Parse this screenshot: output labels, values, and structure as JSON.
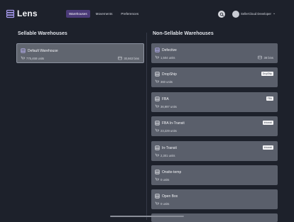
{
  "app": {
    "name": "Lens"
  },
  "nav": {
    "items": [
      "Warehouses",
      "Movements",
      "Preferences"
    ]
  },
  "user": {
    "name": "SellerCloud Developer"
  },
  "sections": {
    "sellable_title": "Sellable Warehouses",
    "nonsellable_title": "Non-Sellable Warehouses"
  },
  "sellable": [
    {
      "name": "Default Warehouse",
      "units": "775,468 units",
      "bins": "30,663 bins"
    }
  ],
  "nonsellable": [
    {
      "name": "Defective",
      "units": "1,504 units",
      "bins": "38 bins",
      "badge": ""
    },
    {
      "name": "DropShip",
      "units": "360 units",
      "bins": "",
      "badge": "DropShip"
    },
    {
      "name": "FBA",
      "units": "36,997 units",
      "bins": "",
      "badge": "FBA"
    },
    {
      "name": "FBA In-Transit",
      "units": "23,229 units",
      "bins": "",
      "badge": "Intransit"
    },
    {
      "name": "In-Transit",
      "units": "2,301 units",
      "bins": "",
      "badge": "Intransit"
    },
    {
      "name": "Onsite-temp",
      "units": "0 units",
      "bins": "",
      "badge": ""
    },
    {
      "name": "Open Box",
      "units": "0 units",
      "bins": "",
      "badge": ""
    }
  ],
  "colors": {
    "background": "#1d212b",
    "card": "#5a5f6b",
    "accent": "#4a3a78"
  },
  "icons": {
    "logo": "stack-icon",
    "search": "search-icon",
    "warehouse": "warehouse-icon",
    "units": "cart-icon",
    "bins": "bin-icon",
    "chevron": "chevron-down-icon"
  }
}
